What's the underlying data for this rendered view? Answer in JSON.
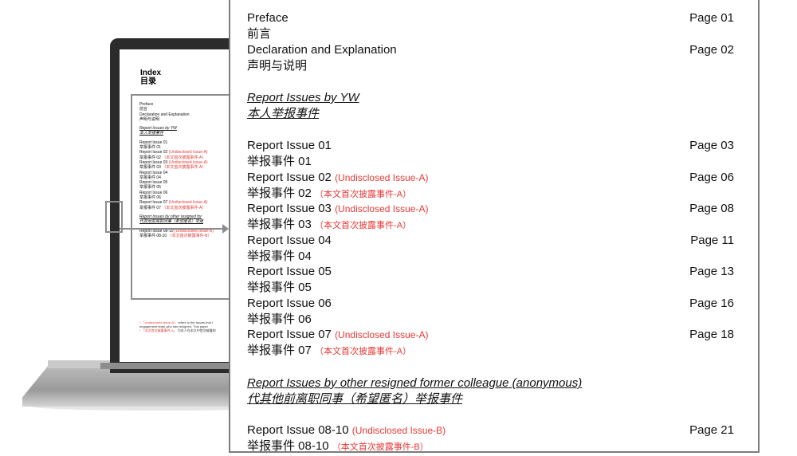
{
  "laptop": {
    "index_title_en": "Index",
    "index_title_cn": "目录",
    "entries": [
      {
        "text": "Preface",
        "red": ""
      },
      {
        "text": "前言",
        "red": ""
      },
      {
        "text": "Declaration and Explanation",
        "red": ""
      },
      {
        "text": "声明与说明",
        "red": ""
      },
      {
        "text": "Report Issues by YW",
        "red": "",
        "heading": true
      },
      {
        "text": "本人举报事件",
        "red": "",
        "heading": true
      },
      {
        "text": "Report Issue 01",
        "red": ""
      },
      {
        "text": "举报事件 01",
        "red": ""
      },
      {
        "text": "Report Issue 02 ",
        "red": "(Undisclosed Issue-A)"
      },
      {
        "text": "举报事件 02 ",
        "red": "（本文首次披露事件-A）"
      },
      {
        "text": "Report Issue 03 ",
        "red": "(Undisclosed Issue-A)"
      },
      {
        "text": "举报事件 03 ",
        "red": "（本文首次披露事件-A）"
      },
      {
        "text": "Report Issue 04",
        "red": ""
      },
      {
        "text": "举报事件 04",
        "red": ""
      },
      {
        "text": "Report Issue 05",
        "red": ""
      },
      {
        "text": "举报事件 05",
        "red": ""
      },
      {
        "text": "Report Issue 06",
        "red": ""
      },
      {
        "text": "举报事件 06",
        "red": ""
      },
      {
        "text": "Report Issue 07 ",
        "red": "(Undisclosed Issue-A)"
      },
      {
        "text": "举报事件 07 ",
        "red": "（本文首次披露事件-A）"
      },
      {
        "text": "Report Issues by other resigned for",
        "red": "",
        "heading": true
      },
      {
        "text": "代其他前离职同事（希望匿名）举报",
        "red": "",
        "heading": true
      },
      {
        "text": "Report Issue 08-10 ",
        "red": "(Undisclosed Issue-B)"
      },
      {
        "text": "举报事件 08-10 ",
        "red": "（本文首次披露事件-B）"
      }
    ],
    "footnote_1_red": "* 「Undisclosed Issue-A」",
    "footnote_1": " refers to the issues that I",
    "footnote_2": "engagement team who had resigned. This paper",
    "footnote_3_red": "* 「本文首次披露事件-A」",
    "footnote_3": " 为本人在本文中首次披露的"
  },
  "panel": {
    "preface_en": "Preface",
    "preface_cn": "前言",
    "preface_page": "Page 01",
    "declaration_en": "Declaration and Explanation",
    "declaration_cn": "声明与说明",
    "declaration_page": "Page 02",
    "section1_en": "Report Issues by YW",
    "section1_cn": "本人举报事件",
    "issues": [
      {
        "en": "Report Issue 01",
        "en_red": "",
        "cn": "举报事件 01",
        "cn_red": "",
        "page": "Page 03"
      },
      {
        "en": "Report Issue 02 ",
        "en_red": "(Undisclosed Issue-A)",
        "cn": "举报事件 02 ",
        "cn_red": "（本文首次披露事件-A）",
        "page": "Page 06"
      },
      {
        "en": "Report Issue 03 ",
        "en_red": "(Undisclosed Issue-A)",
        "cn": "举报事件 03 ",
        "cn_red": "（本文首次披露事件-A）",
        "page": "Page 08"
      },
      {
        "en": "Report Issue 04",
        "en_red": "",
        "cn": "举报事件 04",
        "cn_red": "",
        "page": "Page 11"
      },
      {
        "en": "Report Issue 05",
        "en_red": "",
        "cn": "举报事件 05",
        "cn_red": "",
        "page": "Page 13"
      },
      {
        "en": "Report Issue 06",
        "en_red": "",
        "cn": "举报事件 06",
        "cn_red": "",
        "page": "Page 16"
      },
      {
        "en": "Report Issue 07 ",
        "en_red": "(Undisclosed Issue-A)",
        "cn": "举报事件 07 ",
        "cn_red": "（本文首次披露事件-A）",
        "page": "Page 18"
      }
    ],
    "section2_en": "Report Issues by other resigned former colleague (anonymous)",
    "section2_cn": "代其他前离职同事（希望匿名）举报事件",
    "last_issue": {
      "en": "Report Issue 08-10 ",
      "en_red": "(Undisclosed Issue-B)",
      "cn": "举报事件 08-10 ",
      "cn_red": "（本文首次披露事件-B）",
      "page": "Page 21"
    }
  }
}
